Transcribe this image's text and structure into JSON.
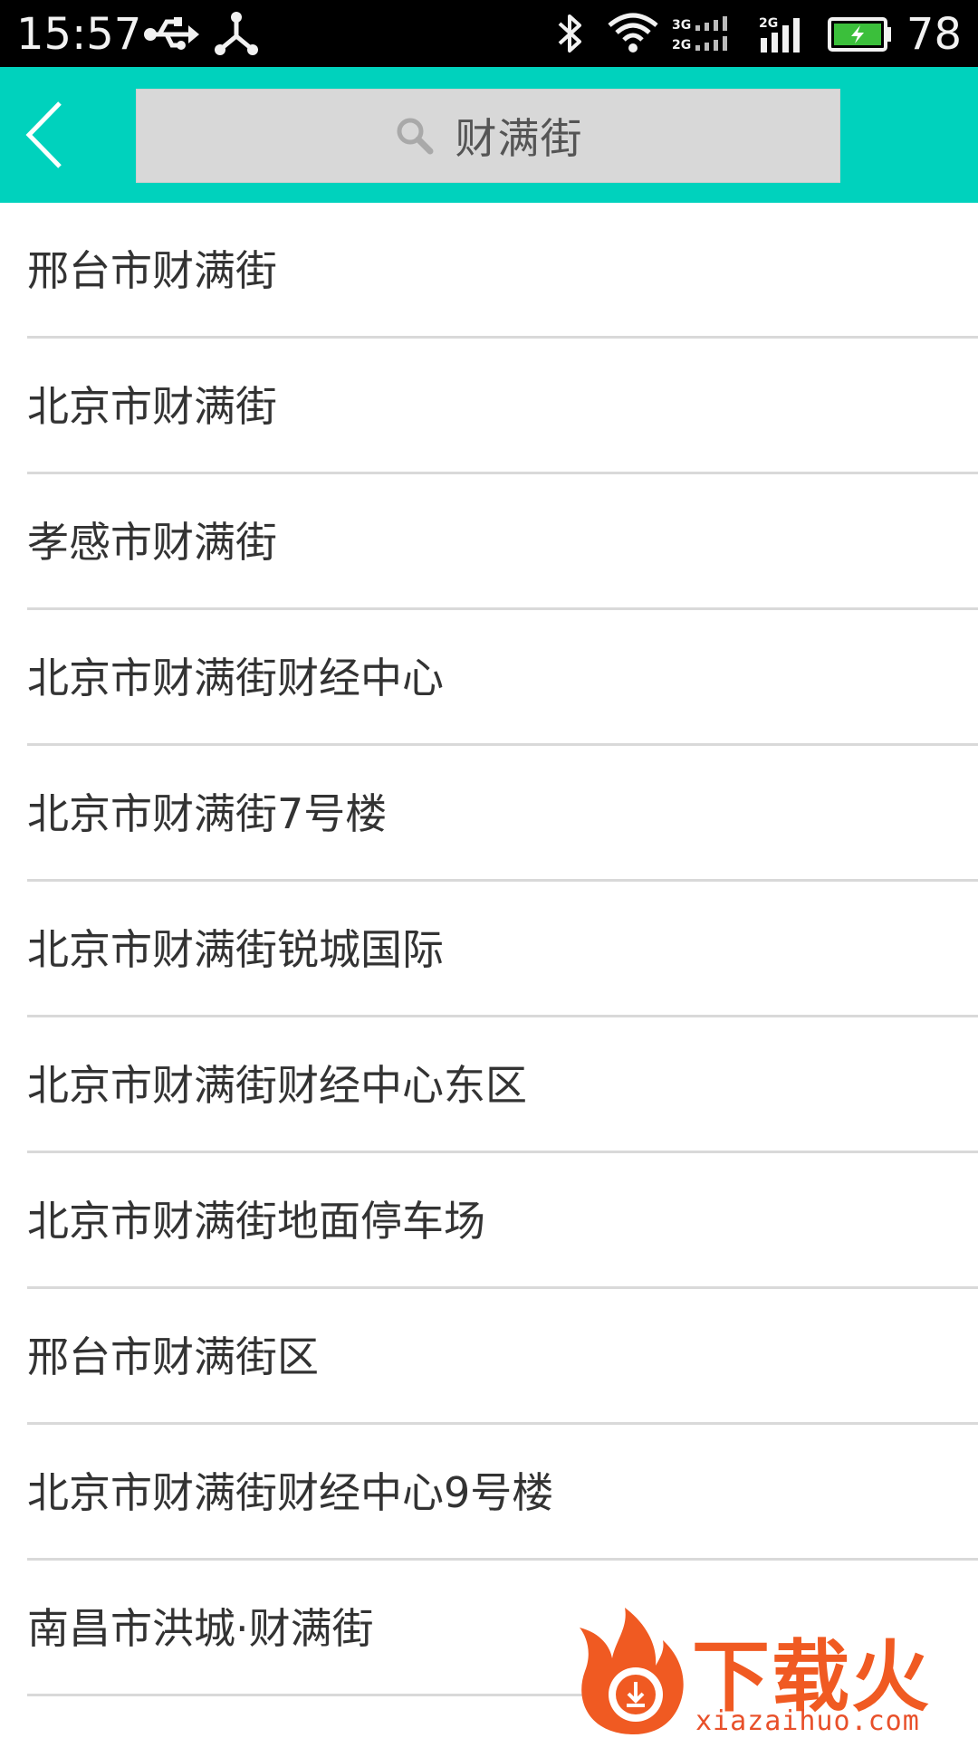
{
  "status_bar": {
    "time": "15:57",
    "battery_level": "78",
    "icons": [
      "usb-icon",
      "share-icon",
      "bluetooth-icon",
      "wifi-icon",
      "signal-3g-2g-icon",
      "signal-2g-icon",
      "battery-charging-icon"
    ]
  },
  "header": {
    "back_icon": "chevron-left-icon",
    "search": {
      "icon": "search-icon",
      "value": "财满街"
    }
  },
  "results": [
    {
      "label": "邢台市财满街"
    },
    {
      "label": "北京市财满街"
    },
    {
      "label": "孝感市财满街"
    },
    {
      "label": "北京市财满街财经中心"
    },
    {
      "label": "北京市财满街7号楼"
    },
    {
      "label": "北京市财满街锐城国际"
    },
    {
      "label": "北京市财满街财经中心东区"
    },
    {
      "label": "北京市财满街地面停车场"
    },
    {
      "label": "邢台市财满街区"
    },
    {
      "label": "北京市财满街财经中心9号楼"
    },
    {
      "label": "南昌市洪城·财满街"
    }
  ],
  "watermark": {
    "title": "下载火",
    "site": "xiazaihuo.com"
  },
  "colors": {
    "header_bg": "#00d2bd",
    "status_bg": "#000000",
    "search_bg": "#d8d8d8",
    "divider": "#d9d9d9",
    "text": "#333333",
    "watermark": "#f05a22"
  }
}
